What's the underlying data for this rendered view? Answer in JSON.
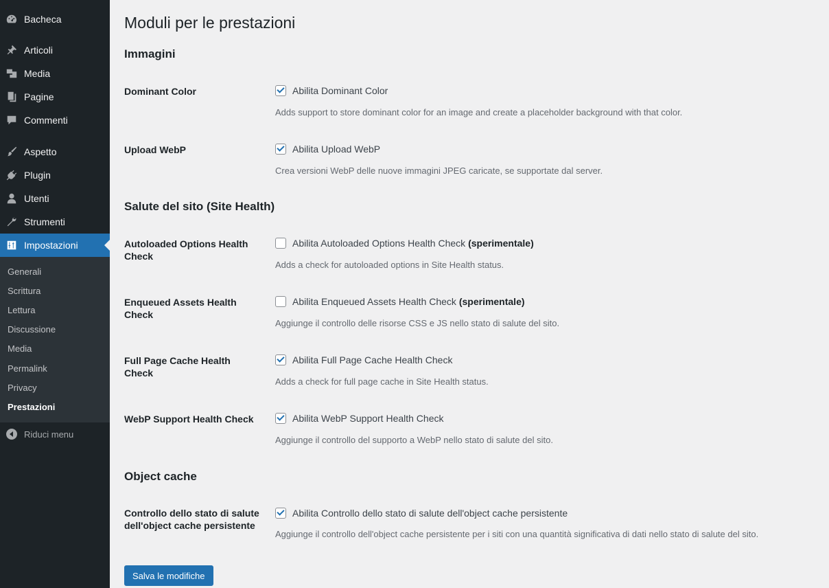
{
  "sidebar": {
    "items": [
      {
        "label": "Bacheca",
        "icon": "dashboard-icon"
      },
      {
        "label": "Articoli",
        "icon": "pin-icon"
      },
      {
        "label": "Media",
        "icon": "media-icon"
      },
      {
        "label": "Pagine",
        "icon": "pages-icon"
      },
      {
        "label": "Commenti",
        "icon": "comments-icon"
      },
      {
        "label": "Aspetto",
        "icon": "paintbrush-icon"
      },
      {
        "label": "Plugin",
        "icon": "plugin-icon"
      },
      {
        "label": "Utenti",
        "icon": "user-icon"
      },
      {
        "label": "Strumenti",
        "icon": "wrench-icon"
      },
      {
        "label": "Impostazioni",
        "icon": "settings-icon",
        "active": true
      }
    ],
    "submenu": [
      "Generali",
      "Scrittura",
      "Lettura",
      "Discussione",
      "Media",
      "Permalink",
      "Privacy",
      "Prestazioni"
    ],
    "current_submenu": "Prestazioni",
    "collapse_label": "Riduci menu"
  },
  "page": {
    "title": "Moduli per le prestazioni",
    "sections": [
      {
        "heading": "Immagini",
        "rows": [
          {
            "label": "Dominant Color",
            "checkbox_label": "Abilita Dominant Color",
            "experimental": "",
            "checked": true,
            "description": "Adds support to store dominant color for an image and create a placeholder background with that color."
          },
          {
            "label": "Upload WebP",
            "checkbox_label": "Abilita Upload WebP",
            "experimental": "",
            "checked": true,
            "description": "Crea versioni WebP delle nuove immagini JPEG caricate, se supportate dal server."
          }
        ]
      },
      {
        "heading": "Salute del sito (Site Health)",
        "rows": [
          {
            "label": "Autoloaded Options Health Check",
            "checkbox_label": "Abilita Autoloaded Options Health Check",
            "experimental": "(sperimentale)",
            "checked": false,
            "description": "Adds a check for autoloaded options in Site Health status."
          },
          {
            "label": "Enqueued Assets Health Check",
            "checkbox_label": "Abilita Enqueued Assets Health Check",
            "experimental": "(sperimentale)",
            "checked": false,
            "description": "Aggiunge il controllo delle risorse CSS e JS nello stato di salute del sito."
          },
          {
            "label": "Full Page Cache Health Check",
            "checkbox_label": "Abilita Full Page Cache Health Check",
            "experimental": "",
            "checked": true,
            "description": "Adds a check for full page cache in Site Health status."
          },
          {
            "label": "WebP Support Health Check",
            "checkbox_label": "Abilita WebP Support Health Check",
            "experimental": "",
            "checked": true,
            "description": "Aggiunge il controllo del supporto a WebP nello stato di salute del sito."
          }
        ]
      },
      {
        "heading": "Object cache",
        "rows": [
          {
            "label": "Controllo dello stato di salute dell'object cache persistente",
            "checkbox_label": "Abilita Controllo dello stato di salute dell'object cache persistente",
            "experimental": "",
            "checked": true,
            "description": "Aggiunge il controllo dell'object cache persistente per i siti con una quantità significativa di dati nello stato di salute del sito."
          }
        ]
      }
    ],
    "save_label": "Salva le modifiche"
  },
  "colors": {
    "sidebar_bg": "#1d2327",
    "accent": "#2271b1",
    "page_bg": "#f0f0f1"
  }
}
